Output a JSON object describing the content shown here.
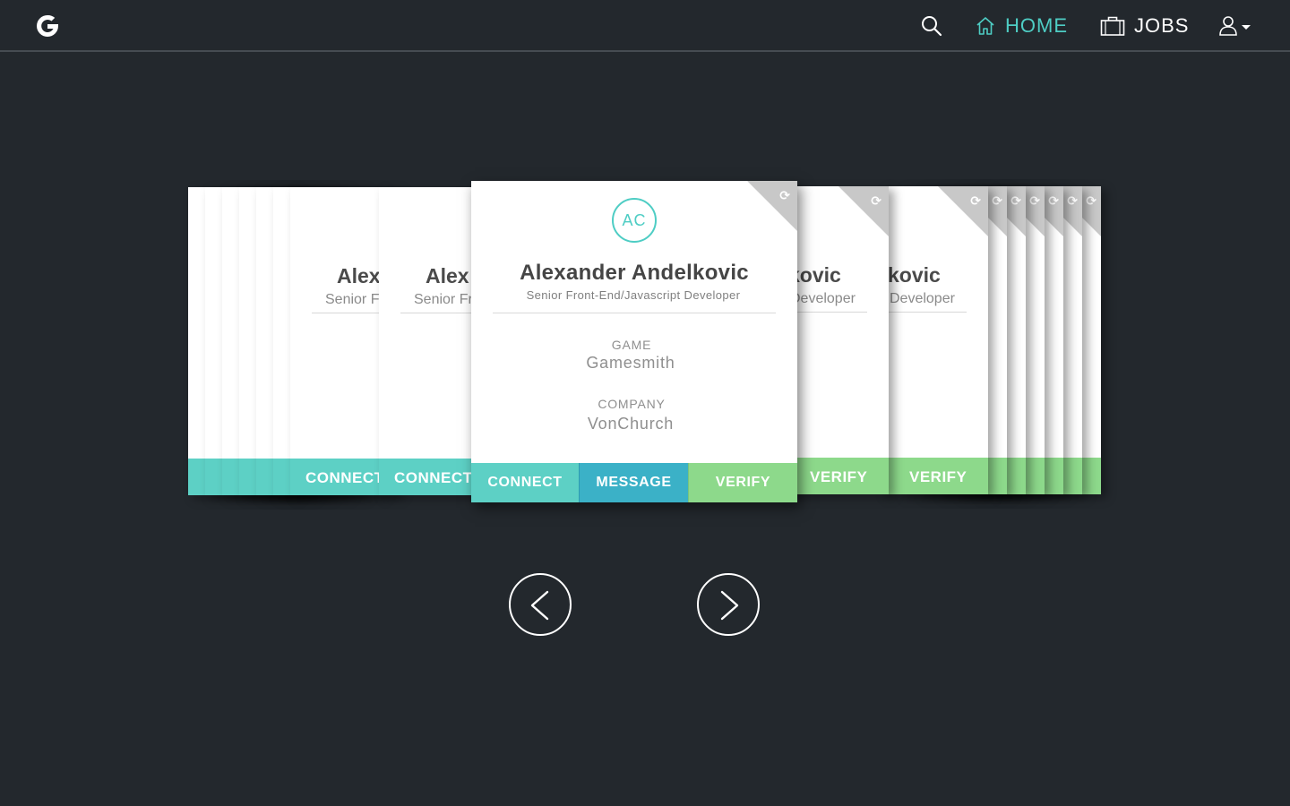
{
  "nav": {
    "logo": "G-logo",
    "home_label": "HOME",
    "jobs_label": "JOBS"
  },
  "colors": {
    "background": "#23282d",
    "accent_teal": "#4ecdc4",
    "connect": "#5dd0c5",
    "message": "#3bb1c7",
    "verify": "#8dd98b"
  },
  "main_card": {
    "initials": "AC",
    "name": "Alexander Andelkovic",
    "title": "Senior Front-End/Javascript Developer",
    "game_label": "GAME",
    "game_value": "Gamesmith",
    "company_label": "COMPANY",
    "company_value": "VonChurch",
    "connect_label": "CONNECT",
    "message_label": "MESSAGE",
    "verify_label": "VERIFY"
  },
  "left_cards": {
    "name_fragment": "Alex",
    "title_fragment": "Senior Fr",
    "connect_label": "CONNECT"
  },
  "right_cards": {
    "name_fragment": "kovic",
    "title_fragment": "Developer",
    "verify_label": "VERIFY"
  },
  "icons": {
    "search": "search-icon",
    "home": "home-icon",
    "jobs": "briefcase-icon",
    "user": "user-icon",
    "flip": "flip-icon",
    "prev": "chevron-left-icon",
    "next": "chevron-right-icon"
  }
}
